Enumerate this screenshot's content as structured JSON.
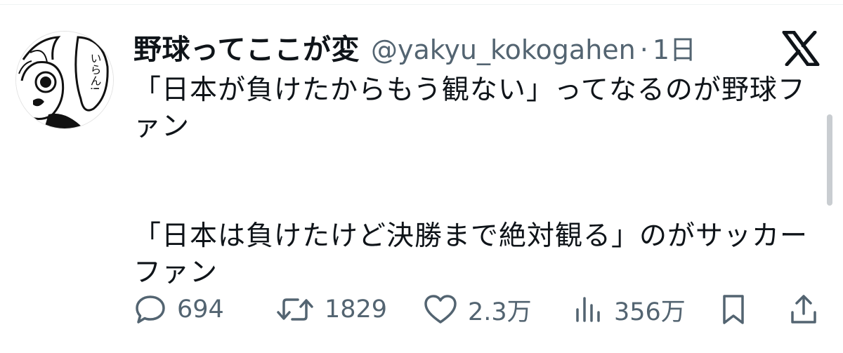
{
  "tweet": {
    "display_name": "野球ってここが変",
    "handle": "@yakyu_kokogahen",
    "separator": "·",
    "time": "1日",
    "avatar_text": "いらん!",
    "paragraph1": "「日本が負けたからもう観ない」ってなるのが野球ファン",
    "paragraph2": "「日本は負けたけど決勝まで絶対観る」のがサッカーファン"
  },
  "actions": {
    "replies": "694",
    "retweets": "1829",
    "likes": "2.3万",
    "views": "356万"
  },
  "icons": {
    "reply": "speech-bubble-icon",
    "retweet": "retweet-icon",
    "like": "heart-icon",
    "views": "bar-chart-icon",
    "bookmark": "bookmark-icon",
    "share": "share-icon",
    "brand": "x-logo-icon"
  },
  "colors": {
    "text": "#0f1419",
    "secondary": "#536471"
  }
}
